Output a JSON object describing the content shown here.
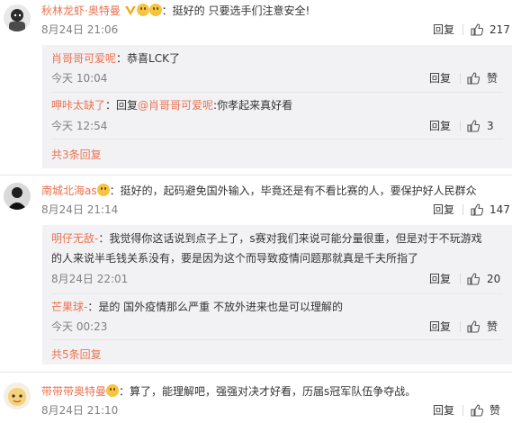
{
  "comments": [
    {
      "user": "秋林龙虾·奥特曼",
      "text": "：挺好的 只要选手们注意安全!",
      "time": "8月24日 21:06",
      "reply_label": "回复",
      "likes": "217",
      "replies": [
        {
          "user": "肖哥哥可爱呢",
          "text": "：恭喜LCK了",
          "time": "今天 10:04",
          "reply_label": "回复",
          "likes": "赞"
        },
        {
          "user": "呷咔太缺了",
          "text_prefix": "：回复",
          "mention": "@肖哥哥可爱呢",
          "text": ":你孝起来真好看",
          "time": "今天 12:54",
          "reply_label": "回复",
          "likes": "3"
        }
      ],
      "expand": "共3条回复"
    },
    {
      "user": "南城北海as",
      "text": "：挺好的，起码避免国外输入，毕竟还是有不看比赛的人，要保护好人民群众",
      "time": "8月24日 21:14",
      "reply_label": "回复",
      "likes": "147",
      "replies": [
        {
          "user": "明仔无敌-",
          "text": "：我觉得你这话说到点子上了，s赛对我们来说可能分量很重，但是对于不玩游戏",
          "text2": "的人来说半毛钱关系没有，要是因为这个而导致疫情问题那就真是千夫所指了",
          "time": "8月24日 22:01",
          "reply_label": "回复",
          "likes": "20"
        },
        {
          "user": "芒果球-",
          "text": "：是的 国外疫情那么严重 不放外进来也是可以理解的",
          "time": "今天 00:23",
          "reply_label": "回复",
          "likes": "赞"
        }
      ],
      "expand": "共5条回复"
    },
    {
      "user": "带带带奥特曼",
      "text": "：算了，能理解吧，强强对决才好看，历届s冠军队伍争夺战。",
      "time": "8月24日 21:10",
      "reply_label": "回复",
      "likes": "赞"
    }
  ],
  "colors": {
    "username": "#eb7350",
    "reply_bg": "#f2f2f5",
    "meta": "#808080"
  }
}
